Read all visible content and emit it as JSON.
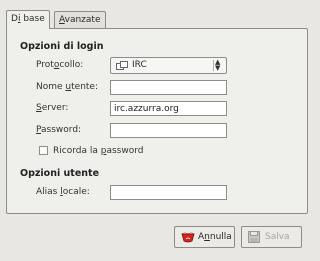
{
  "tabs": [
    {
      "label_pre": "D",
      "label_ul": "i",
      "label_post": " base"
    },
    {
      "label_pre": "",
      "label_ul": "A",
      "label_post": "vanzate"
    }
  ],
  "login": {
    "title": "Opzioni di login",
    "protocol": {
      "label_pre": "Prot",
      "label_ul": "o",
      "label_post": "collo:",
      "value": "IRC"
    },
    "username": {
      "label_pre": "Nome ",
      "label_ul": "u",
      "label_post": "tente:",
      "value": ""
    },
    "server": {
      "label_pre": "",
      "label_ul": "S",
      "label_post": "erver:",
      "value": "irc.azzurra.org"
    },
    "password": {
      "label_pre": "",
      "label_ul": "P",
      "label_post": "assword:",
      "value": ""
    },
    "remember": {
      "label_pre": "Ricorda la ",
      "label_ul": "p",
      "label_post": "assword",
      "checked": false
    }
  },
  "user": {
    "title": "Opzioni utente",
    "alias": {
      "label_pre": "Alias ",
      "label_ul": "l",
      "label_post": "ocale:",
      "value": ""
    }
  },
  "buttons": {
    "cancel": {
      "label_pre": "A",
      "label_ul": "n",
      "label_post": "nulla"
    },
    "save": {
      "label_pre": "",
      "label_ul": "",
      "label_post": "Salva"
    }
  },
  "colors": {
    "cancel_icon": "#d0261d",
    "accent": "#4c7fc0"
  }
}
